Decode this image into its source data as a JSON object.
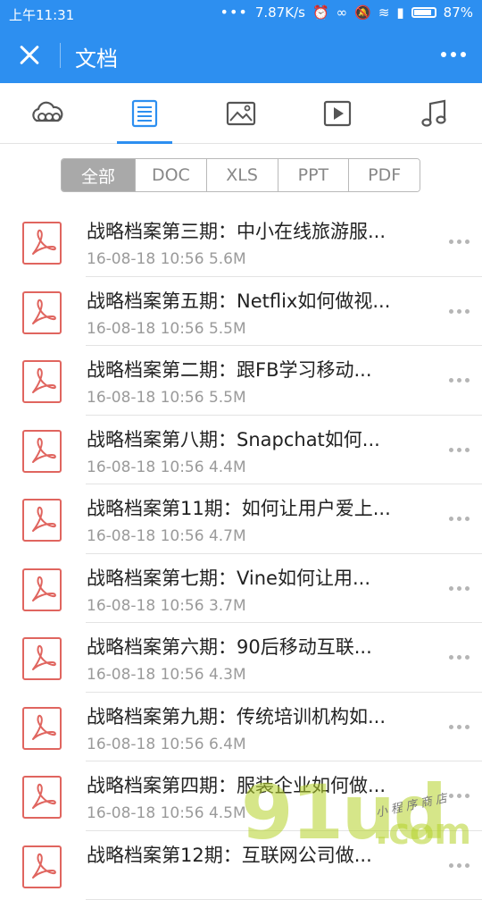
{
  "status_bar": {
    "time": "上午11:31",
    "speed": "7.87K/s",
    "battery": "87%",
    "dots": "•••"
  },
  "header": {
    "title": "文档"
  },
  "category_tabs": [
    {
      "icon": "cloud-icon",
      "active": false
    },
    {
      "icon": "document-icon",
      "active": true
    },
    {
      "icon": "image-icon",
      "active": false
    },
    {
      "icon": "video-icon",
      "active": false
    },
    {
      "icon": "music-icon",
      "active": false
    }
  ],
  "filters": [
    "全部",
    "DOC",
    "XLS",
    "PPT",
    "PDF"
  ],
  "selected_filter": "全部",
  "files": [
    {
      "name": "战略档案第三期：中小在线旅游服...",
      "meta": "16-08-18 10:56 5.6M"
    },
    {
      "name": "战略档案第五期：Netflix如何做视...",
      "meta": "16-08-18 10:56 5.5M"
    },
    {
      "name": "战略档案第二期：跟FB学习移动...",
      "meta": "16-08-18 10:56 5.5M"
    },
    {
      "name": "战略档案第八期：Snapchat如何...",
      "meta": "16-08-18 10:56 4.4M"
    },
    {
      "name": "战略档案第11期：如何让用户爱上...",
      "meta": "16-08-18 10:56 4.7M"
    },
    {
      "name": "战略档案第七期：Vine如何让用...",
      "meta": "16-08-18 10:56 3.7M"
    },
    {
      "name": "战略档案第六期：90后移动互联...",
      "meta": "16-08-18 10:56 4.3M"
    },
    {
      "name": "战略档案第九期：传统培训机构如...",
      "meta": "16-08-18 10:56 6.4M"
    },
    {
      "name": "战略档案第四期：服装企业如何做...",
      "meta": "16-08-18 10:56 4.5M"
    },
    {
      "name": "战略档案第12期：互联网公司做...",
      "meta": ""
    }
  ],
  "watermark": {
    "main": "91ud",
    "suffix": ".com",
    "tagline": "小程序商店"
  },
  "colors": {
    "accent": "#2d8ff0",
    "pdf_red": "#e0655f"
  }
}
